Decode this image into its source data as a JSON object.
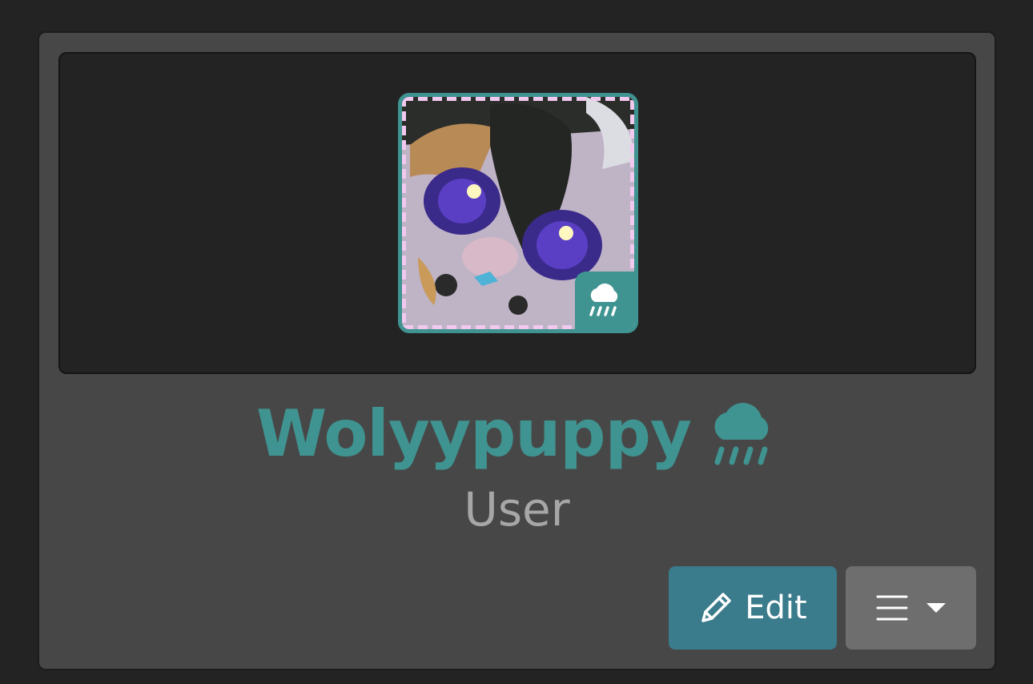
{
  "profile": {
    "username": "Wolyypuppy",
    "role": "User",
    "status_icon": "cloud-rain-icon",
    "avatar_badge_icon": "cloud-rain-icon"
  },
  "actions": {
    "edit_label": "Edit",
    "edit_icon": "pencil-icon",
    "menu_icon": "hamburger-icon",
    "menu_caret_icon": "caret-down-icon"
  },
  "colors": {
    "accent": "#3f9390",
    "edit_button": "#3a7b8c",
    "menu_button": "#6e6e6e",
    "card_bg": "#474747",
    "banner_bg": "#232323",
    "role_text": "#a7a7a7"
  }
}
